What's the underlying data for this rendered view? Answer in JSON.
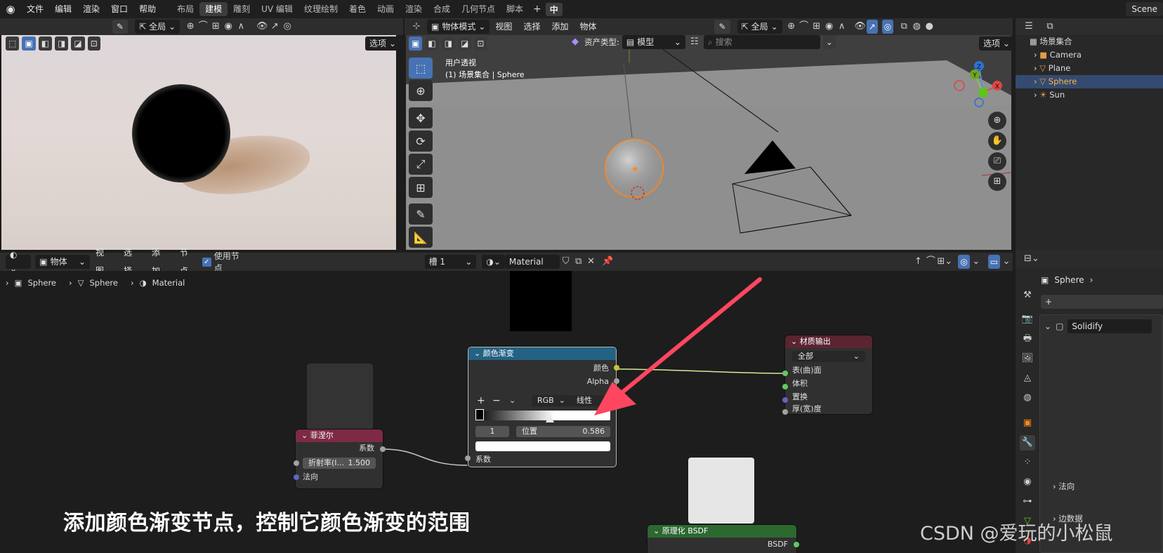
{
  "menu": {
    "items": [
      "文件",
      "编辑",
      "渲染",
      "窗口",
      "帮助"
    ],
    "workspaces": [
      "布局",
      "建模",
      "雕刻",
      "UV 编辑",
      "纹理绘制",
      "着色",
      "动画",
      "渲染",
      "合成",
      "几何节点",
      "脚本"
    ],
    "active_workspace": "建模",
    "add_label": "+",
    "lang_label": "中",
    "scene_label": "Scene"
  },
  "render_header": {
    "view_mode": "全局",
    "options_label": "选项"
  },
  "viewport_header": {
    "mode": "物体模式",
    "menus": [
      "视图",
      "选择",
      "添加",
      "物体"
    ],
    "orientation": "全局",
    "options_label": "选项"
  },
  "asset_bar": {
    "type_label": "资产类型:",
    "type_value": "模型",
    "search_placeholder": "搜索"
  },
  "viewport": {
    "view_name": "用户透视",
    "collection_info": "(1) 场景集合 | Sphere"
  },
  "gizmo": {
    "z": "Z",
    "y": "Y",
    "x": "X"
  },
  "outliner": {
    "root": "场景集合",
    "items": [
      "Camera",
      "Plane",
      "Sphere",
      "Sun"
    ],
    "selected": "Sphere"
  },
  "node_header": {
    "editor_type": "物体",
    "menus": [
      "视图",
      "选择",
      "添加",
      "节点"
    ],
    "use_nodes_label": "使用节点",
    "slot": "槽 1",
    "material": "Material"
  },
  "breadcrumb": [
    "Sphere",
    "Sphere",
    "Material"
  ],
  "nodes": {
    "fresnel": {
      "title": "菲涅尔",
      "output": "系数",
      "ior_label": "折射率(I...",
      "ior_value": "1.500",
      "normal": "法向"
    },
    "color_ramp": {
      "title": "颜色渐变",
      "out_color": "颜色",
      "out_alpha": "Alpha",
      "add": "+",
      "remove": "−",
      "menu": "⌄",
      "color_mode": "RGB",
      "interpolation": "线性",
      "index": "1",
      "position_label": "位置",
      "position_value": "0.586",
      "input": "系数"
    },
    "material_output": {
      "title": "材质输出",
      "target": "全部",
      "inputs": [
        "表(曲)面",
        "体积",
        "置换",
        "厚(宽)度"
      ]
    },
    "principled": {
      "title": "原理化 BSDF",
      "output": "BSDF"
    }
  },
  "properties": {
    "object": "Sphere",
    "add_label": "+",
    "modifier": "Solidify",
    "normal_label": "法向",
    "edge_data_label": "边数据"
  },
  "caption": "添加颜色渐变节点，控制它颜色渐变的范围",
  "watermark": "CSDN @爱玩的小松鼠",
  "colors": {
    "fresnel_header": "#7e2a44",
    "ramp_header": "#246283",
    "output_header": "#5a2430",
    "bsdf_header": "#2c6830",
    "selection": "#ff8a1f",
    "arrow": "#ff4660"
  }
}
